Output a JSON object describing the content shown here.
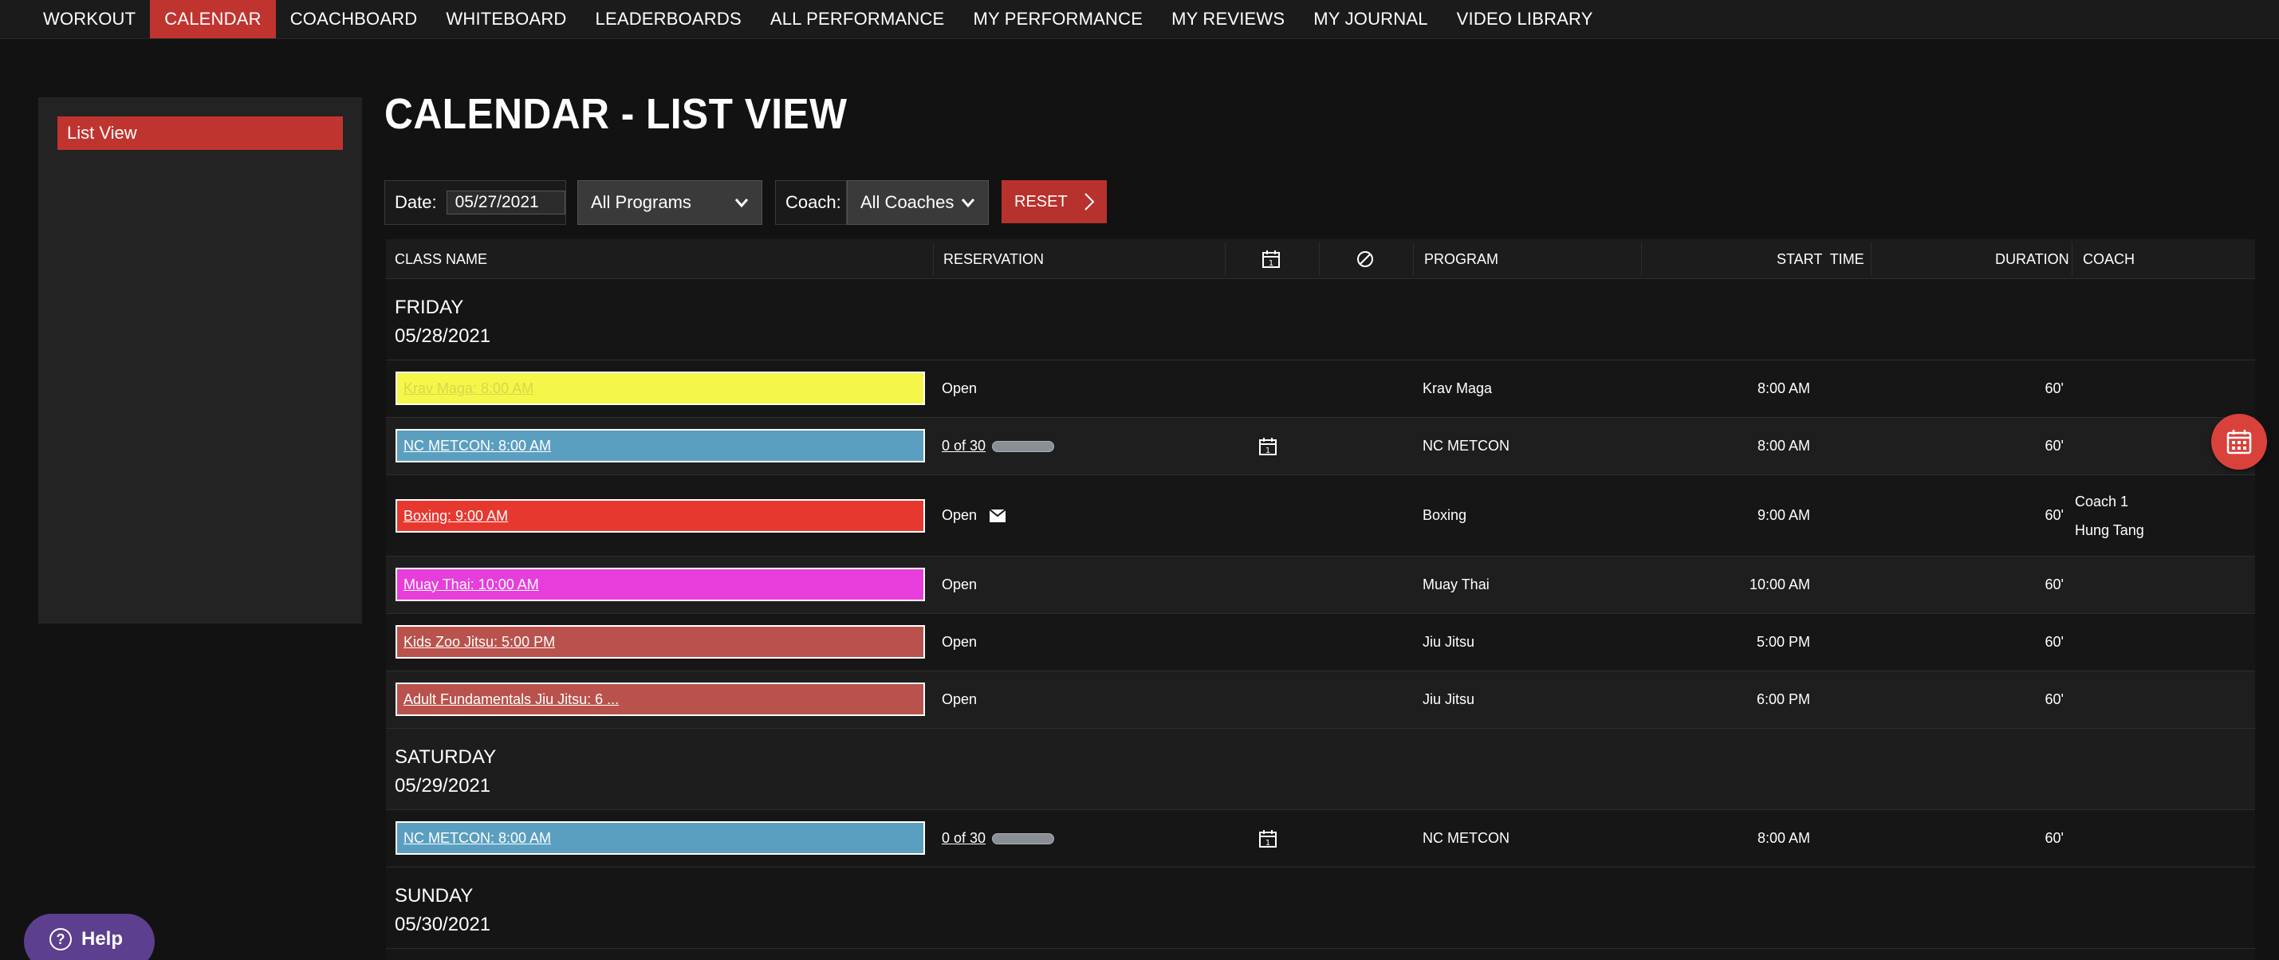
{
  "nav": {
    "items": [
      {
        "label": "WORKOUT",
        "active": false
      },
      {
        "label": "CALENDAR",
        "active": true
      },
      {
        "label": "COACHBOARD",
        "active": false
      },
      {
        "label": "WHITEBOARD",
        "active": false
      },
      {
        "label": "LEADERBOARDS",
        "active": false
      },
      {
        "label": "ALL PERFORMANCE",
        "active": false
      },
      {
        "label": "MY PERFORMANCE",
        "active": false
      },
      {
        "label": "MY REVIEWS",
        "active": false
      },
      {
        "label": "MY JOURNAL",
        "active": false
      },
      {
        "label": "VIDEO LIBRARY",
        "active": false
      }
    ]
  },
  "sidebar": {
    "items": [
      {
        "label": "List View",
        "active": true
      }
    ]
  },
  "page": {
    "title": "CALENDAR - LIST VIEW"
  },
  "filters": {
    "date_label": "Date:",
    "date_value": "05/27/2021",
    "program_value": "All Programs",
    "coach_label": "Coach:",
    "coach_value": "All Coaches",
    "reset_label": "RESET"
  },
  "table": {
    "headers": {
      "class_name": "CLASS NAME",
      "reservation": "RESERVATION",
      "program": "PROGRAM",
      "start_time": "START  TIME",
      "duration": "DURATION",
      "coach": "COACH"
    },
    "days": [
      {
        "name": "FRIDAY",
        "date": "05/28/2021",
        "classes": [
          {
            "name": "Krav Maga: 8:00 AM",
            "color": "#f4f64a",
            "reservation": "Open",
            "program": "Krav Maga",
            "start": "8:00 AM",
            "duration": "60'",
            "coaches": []
          },
          {
            "name": "NC METCON: 8:00 AM",
            "color": "#5b9fc0",
            "reservation": "0 of 30",
            "progress": 0,
            "calendar_icon": true,
            "program": "NC METCON",
            "start": "8:00 AM",
            "duration": "60'",
            "coaches": []
          },
          {
            "name": "Boxing: 9:00 AM",
            "color": "#e7382f",
            "reservation": "Open",
            "mail_icon": true,
            "program": "Boxing",
            "start": "9:00 AM",
            "duration": "60'",
            "coaches": [
              "Coach 1",
              "Hung Tang"
            ]
          },
          {
            "name": "Muay Thai: 10:00 AM",
            "color": "#e63ddb",
            "reservation": "Open",
            "program": "Muay Thai",
            "start": "10:00 AM",
            "duration": "60'",
            "coaches": []
          },
          {
            "name": "Kids Zoo Jitsu: 5:00 PM",
            "color": "#b9524c",
            "reservation": "Open",
            "program": "Jiu Jitsu",
            "start": "5:00 PM",
            "duration": "60'",
            "coaches": []
          },
          {
            "name": "Adult Fundamentals Jiu Jitsu: 6 ...",
            "color": "#b9524c",
            "reservation": "Open",
            "program": "Jiu Jitsu",
            "start": "6:00 PM",
            "duration": "60'",
            "coaches": []
          }
        ]
      },
      {
        "name": "SATURDAY",
        "date": "05/29/2021",
        "classes": [
          {
            "name": "NC METCON: 8:00 AM",
            "color": "#5b9fc0",
            "reservation": "0 of 30",
            "progress": 0,
            "calendar_icon": true,
            "program": "NC METCON",
            "start": "8:00 AM",
            "duration": "60'",
            "coaches": []
          }
        ]
      },
      {
        "name": "SUNDAY",
        "date": "05/30/2021",
        "classes": [
          {
            "name": "",
            "color": "#5b9fc0",
            "reservation": "",
            "program": "",
            "start": "",
            "duration": "",
            "coaches": []
          }
        ]
      }
    ]
  },
  "help": {
    "label": "Help"
  },
  "colors": {
    "accent": "#c0342f",
    "help": "#5d3f8f"
  }
}
